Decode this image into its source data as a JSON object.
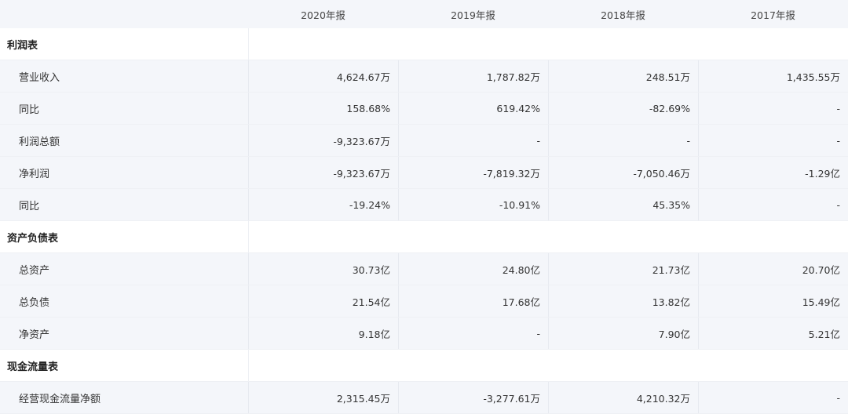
{
  "headers": [
    "2020年报",
    "2019年报",
    "2018年报",
    "2017年报"
  ],
  "sections": [
    {
      "title": "利润表",
      "rows": [
        {
          "label": "营业收入",
          "values": [
            "4,624.67万",
            "1,787.82万",
            "248.51万",
            "1,435.55万"
          ]
        },
        {
          "label": "同比",
          "values": [
            "158.68%",
            "619.42%",
            "-82.69%",
            "-"
          ]
        },
        {
          "label": "利润总额",
          "values": [
            "-9,323.67万",
            "-",
            "-",
            "-"
          ]
        },
        {
          "label": "净利润",
          "values": [
            "-9,323.67万",
            "-7,819.32万",
            "-7,050.46万",
            "-1.29亿"
          ]
        },
        {
          "label": "同比",
          "values": [
            "-19.24%",
            "-10.91%",
            "45.35%",
            "-"
          ]
        }
      ]
    },
    {
      "title": "资产负债表",
      "rows": [
        {
          "label": "总资产",
          "values": [
            "30.73亿",
            "24.80亿",
            "21.73亿",
            "20.70亿"
          ]
        },
        {
          "label": "总负债",
          "values": [
            "21.54亿",
            "17.68亿",
            "13.82亿",
            "15.49亿"
          ]
        },
        {
          "label": "净资产",
          "values": [
            "9.18亿",
            "-",
            "7.90亿",
            "5.21亿"
          ]
        }
      ]
    },
    {
      "title": "现金流量表",
      "rows": [
        {
          "label": "经营现金流量净额",
          "values": [
            "2,315.45万",
            "-3,277.61万",
            "4,210.32万",
            "-"
          ]
        }
      ]
    }
  ]
}
